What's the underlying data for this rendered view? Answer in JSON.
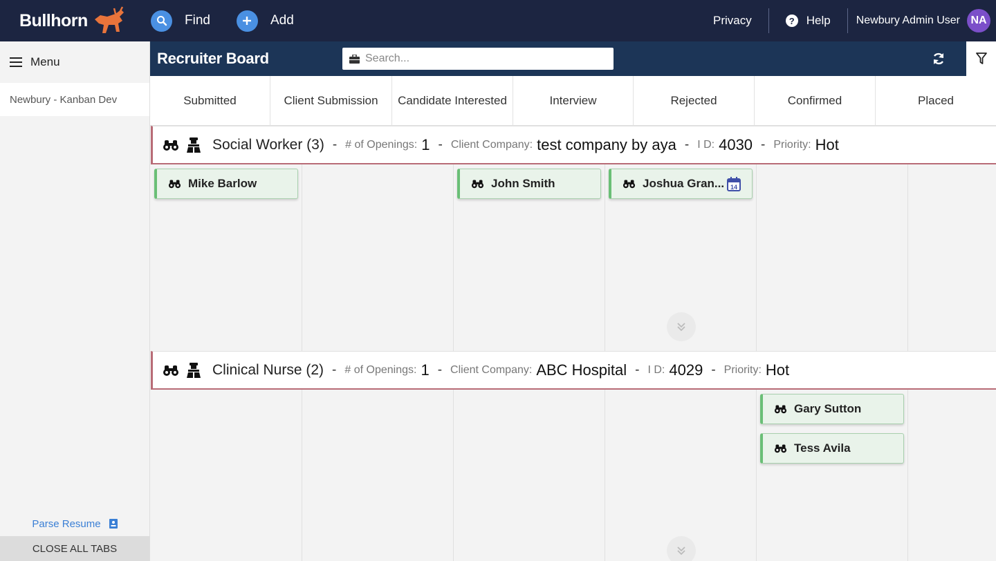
{
  "nav": {
    "brand": "Bullhorn",
    "find_label": "Find",
    "add_label": "Add",
    "privacy_label": "Privacy",
    "help_label": "Help",
    "user_name": "Newbury Admin User",
    "user_initials": "NA"
  },
  "sidebar": {
    "menu_label": "Menu",
    "tabs": [
      {
        "label": "Newbury - Kanban Dev"
      }
    ],
    "parse_resume_label": "Parse Resume",
    "close_all_tabs_label": "CLOSE ALL TABS"
  },
  "board": {
    "title": "Recruiter Board",
    "search_placeholder": "Search...",
    "columns": [
      "Submitted",
      "Client Submission",
      "Candidate Interested",
      "Interview",
      "Rejected",
      "Confirmed",
      "Placed"
    ]
  },
  "lanes": [
    {
      "title": "Social Worker (3)",
      "openings_label": "# of Openings:",
      "openings": "1",
      "company_label": "Client Company:",
      "company": "test company by aya",
      "id_label": "I D:",
      "id": "4030",
      "priority_label": "Priority:",
      "priority": "Hot",
      "cards": [
        {
          "name": "Mike Barlow",
          "column": 0,
          "row": 0,
          "calendar": false
        },
        {
          "name": "John Smith",
          "column": 2,
          "row": 0,
          "calendar": false
        },
        {
          "name": "Joshua Gran...",
          "column": 3,
          "row": 0,
          "calendar": true,
          "calendar_day": "14"
        }
      ]
    },
    {
      "title": "Clinical Nurse (2)",
      "openings_label": "# of Openings:",
      "openings": "1",
      "company_label": "Client Company:",
      "company": "ABC Hospital",
      "id_label": "I D:",
      "id": "4029",
      "priority_label": "Priority:",
      "priority": "Hot",
      "cards": [
        {
          "name": "Gary Sutton",
          "column": 4,
          "row": 0,
          "calendar": false
        },
        {
          "name": "Tess Avila",
          "column": 4,
          "row": 1,
          "calendar": false
        }
      ]
    }
  ],
  "colors": {
    "nav_bg": "#1c2541",
    "board_bar_bg": "#1c3557",
    "card_bg": "#e9f3ea",
    "card_accent": "#6abf76",
    "lane_accent": "#b86b76",
    "avatar_bg": "#7b4fc9",
    "link_blue": "#3a7fd5"
  }
}
